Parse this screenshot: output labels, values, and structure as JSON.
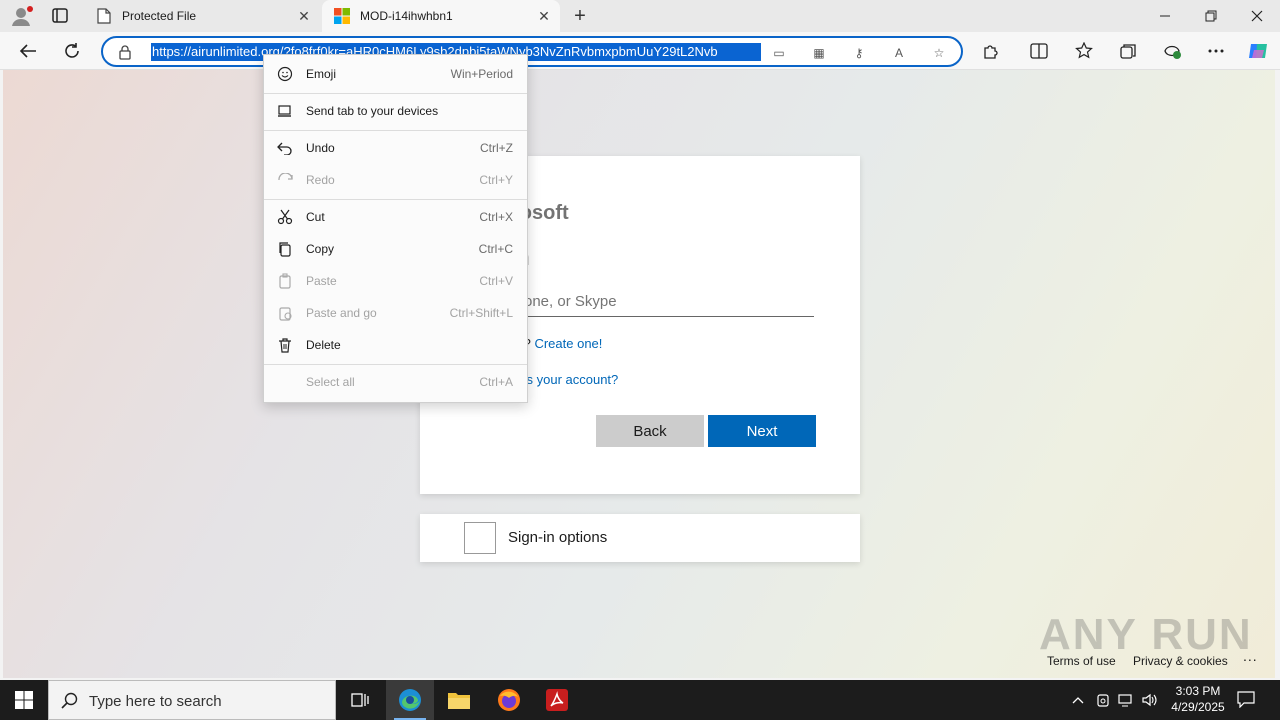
{
  "browser": {
    "tabs": [
      {
        "title": "Protected File",
        "icon": "document-icon",
        "active": false
      },
      {
        "title": "MOD-i14ihwhbn1",
        "icon": "microsoft-logo-icon",
        "active": true
      }
    ],
    "address_bar": {
      "url": "https://airunlimited.org/?fo8frf0kr=aHR0cHM6Ly9sb2dpbi5taWNyb3NvZnRvbmxpbmUuY29tL2Nvb"
    }
  },
  "page": {
    "brand": "rosoft",
    "heading": "n",
    "email_placeholder": "one, or Skype",
    "no_account_prefix": "t?",
    "create_link": "Create one!",
    "cant_access_link": "ss your account?",
    "back_button": "Back",
    "next_button": "Next",
    "signin_options": "Sign-in options",
    "footer": {
      "terms": "Terms of use",
      "privacy": "Privacy & cookies",
      "more": "..."
    },
    "watermark": "ANY RUN"
  },
  "context_menu": {
    "items": [
      {
        "label": "Emoji",
        "shortcut": "Win+Period",
        "icon": "emoji-icon",
        "enabled": true
      },
      {
        "label": "Send tab to your devices",
        "shortcut": "",
        "icon": "devices-icon",
        "enabled": true
      },
      {
        "label": "Undo",
        "shortcut": "Ctrl+Z",
        "icon": "undo-icon",
        "enabled": true
      },
      {
        "label": "Redo",
        "shortcut": "Ctrl+Y",
        "icon": "redo-icon",
        "enabled": false
      },
      {
        "label": "Cut",
        "shortcut": "Ctrl+X",
        "icon": "scissors-icon",
        "enabled": true
      },
      {
        "label": "Copy",
        "shortcut": "Ctrl+C",
        "icon": "copy-icon",
        "enabled": true
      },
      {
        "label": "Paste",
        "shortcut": "Ctrl+V",
        "icon": "paste-icon",
        "enabled": false
      },
      {
        "label": "Paste and go",
        "shortcut": "Ctrl+Shift+L",
        "icon": "paste-go-icon",
        "enabled": false
      },
      {
        "label": "Delete",
        "shortcut": "",
        "icon": "trash-icon",
        "enabled": true
      },
      {
        "label": "Select all",
        "shortcut": "Ctrl+A",
        "icon": "",
        "enabled": false
      }
    ]
  },
  "taskbar": {
    "search_placeholder": "Type here to search",
    "time": "3:03 PM",
    "date": "4/29/2025"
  },
  "colors": {
    "accent": "#0067b8",
    "selection": "#0a64d2",
    "taskbar": "#1c1c1c"
  }
}
